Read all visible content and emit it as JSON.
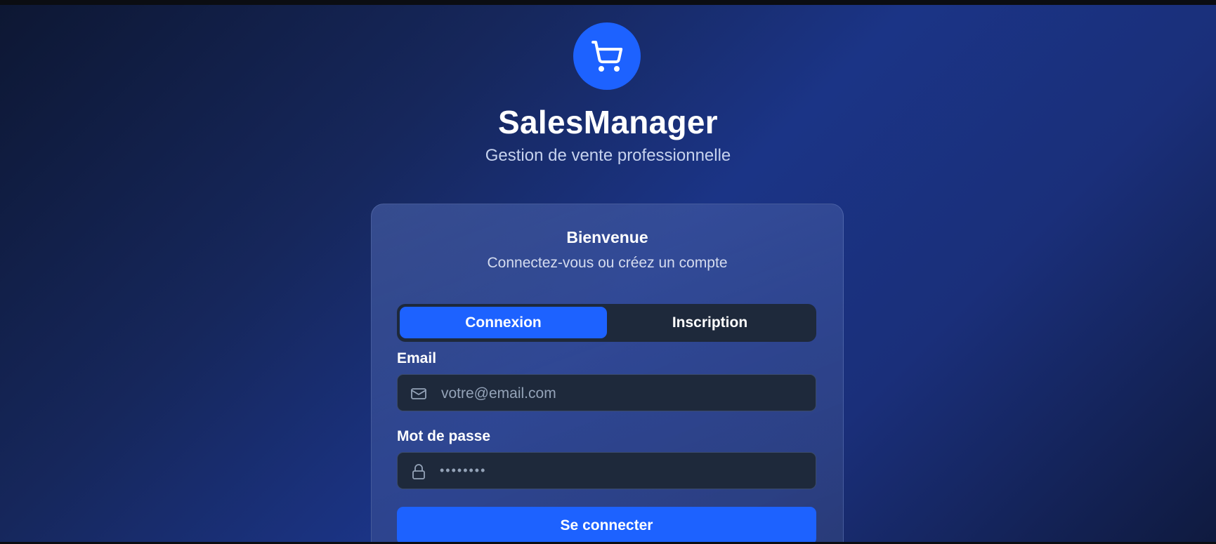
{
  "brand": {
    "icon": "cart-icon",
    "title": "SalesManager",
    "subtitle": "Gestion de vente professionnelle"
  },
  "card": {
    "title": "Bienvenue",
    "subtitle": "Connectez-vous ou créez un compte"
  },
  "tabs": [
    {
      "label": "Connexion",
      "active": true
    },
    {
      "label": "Inscription",
      "active": false
    }
  ],
  "form": {
    "email_label": "Email",
    "email_placeholder": "votre@email.com",
    "email_icon": "mail-icon",
    "password_label": "Mot de passe",
    "password_placeholder": "••••••••",
    "password_icon": "lock-icon",
    "submit_label": "Se connecter"
  },
  "colors": {
    "accent": "#1d62ff",
    "field_bg": "#1e293b",
    "placeholder": "#94a3b8"
  }
}
